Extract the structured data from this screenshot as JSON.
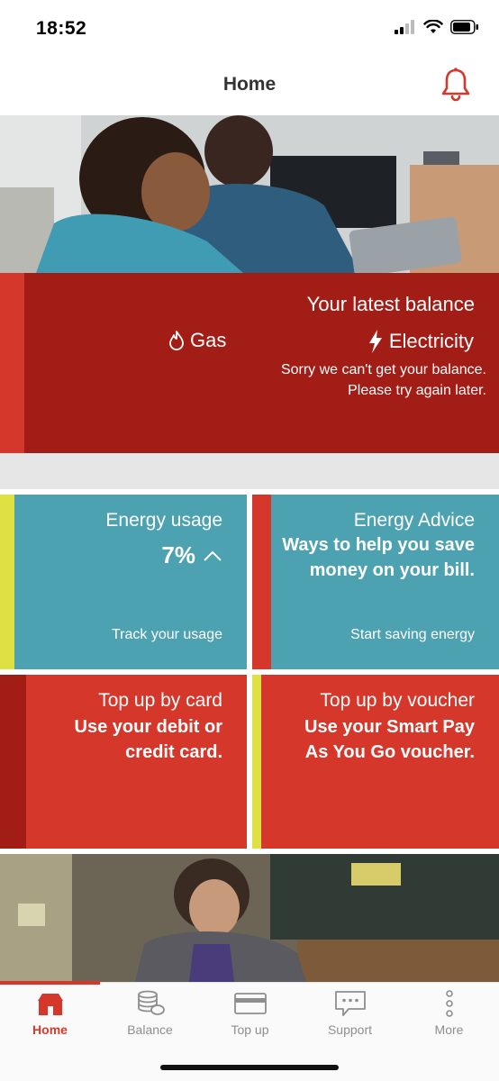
{
  "status_bar": {
    "time": "18:52"
  },
  "header": {
    "title": "Home"
  },
  "balance": {
    "title": "Your latest balance",
    "gas_label": "Gas",
    "electricity_label": "Electricity",
    "message_line1": "Sorry we can't get your balance.",
    "message_line2": "Please try again later."
  },
  "tiles": [
    {
      "title": "Energy usage",
      "value": "7%",
      "link": "Track your usage"
    },
    {
      "title": "Energy Advice",
      "subtitle_line1": "Ways to help you save",
      "subtitle_line2": "money on your bill.",
      "link": "Start saving energy"
    },
    {
      "title": "Top up by card",
      "subtitle_line1": "Use your debit or",
      "subtitle_line2": "credit card."
    },
    {
      "title": "Top up by voucher",
      "subtitle_line1": "Use your Smart Pay",
      "subtitle_line2": "As You Go voucher."
    }
  ],
  "tabs": [
    {
      "label": "Home",
      "icon": "home-icon",
      "active": true
    },
    {
      "label": "Balance",
      "icon": "coins-icon",
      "active": false
    },
    {
      "label": "Top up",
      "icon": "card-icon",
      "active": false
    },
    {
      "label": "Support",
      "icon": "chat-icon",
      "active": false
    },
    {
      "label": "More",
      "icon": "more-icon",
      "active": false
    }
  ],
  "colors": {
    "brand_red": "#d5382a",
    "dark_red": "#a31d17",
    "teal": "#4ca2b1",
    "yellow_strip": "#dfe044"
  }
}
